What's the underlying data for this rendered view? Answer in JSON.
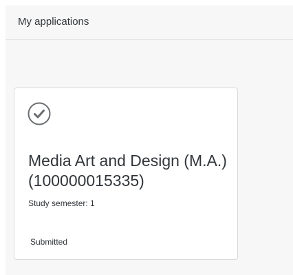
{
  "header": {
    "title": "My applications"
  },
  "applications": [
    {
      "icon": "check-circle-icon",
      "title": "Media Art and Design (M.A.) (100000015335)",
      "subtitle": "Study semester: 1",
      "status": "Submitted"
    }
  ]
}
